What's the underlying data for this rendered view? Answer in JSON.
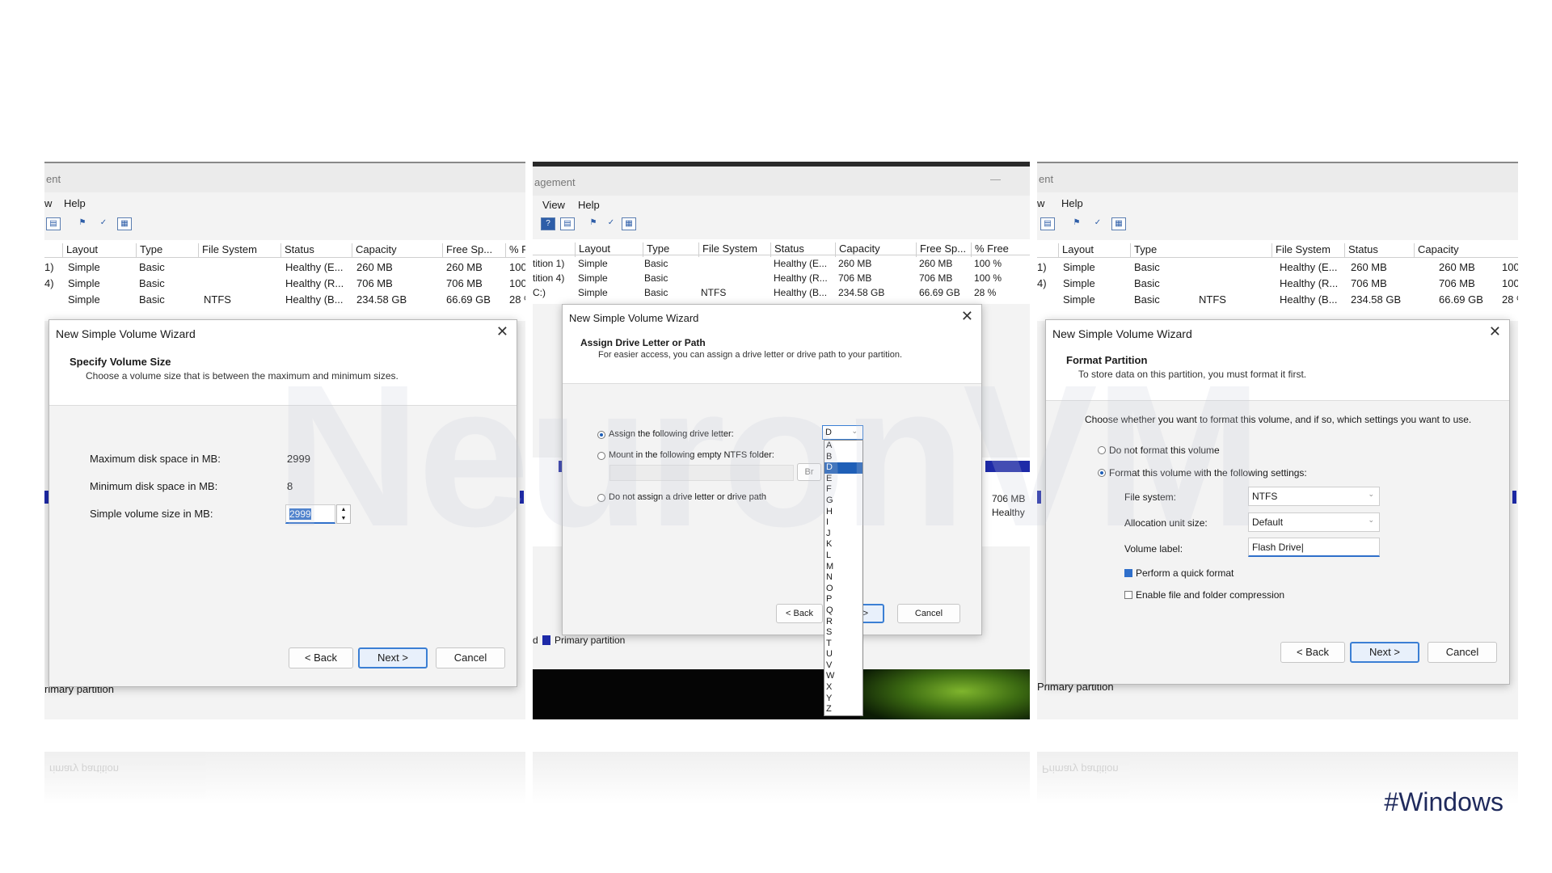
{
  "colors": {
    "accent": "#2f6fca",
    "partition": "#1e2aa8",
    "hashtag": "#1f2a5c"
  },
  "hashtag": "#Windows",
  "watermark": "NeuronVM",
  "grid_headers": [
    "Layout",
    "Type",
    "File System",
    "Status",
    "Capacity",
    "Free Sp...",
    "% Free"
  ],
  "grid_rows": [
    {
      "vol": "1)",
      "layout": "Simple",
      "type": "Basic",
      "fs": "",
      "status": "Healthy (E...",
      "capacity": "260 MB",
      "free": "260 MB",
      "pct": "100 %"
    },
    {
      "vol": "4)",
      "layout": "Simple",
      "type": "Basic",
      "fs": "",
      "status": "Healthy (R...",
      "capacity": "706 MB",
      "free": "706 MB",
      "pct": "100 %"
    },
    {
      "vol": "",
      "layout": "Simple",
      "type": "Basic",
      "fs": "NTFS",
      "status": "Healthy (B...",
      "capacity": "234.58 GB",
      "free": "66.69 GB",
      "pct": "28 %"
    }
  ],
  "panel1": {
    "window_title": "ent",
    "menu": [
      "w",
      "Help"
    ],
    "footer": "rimary partition",
    "dialog": {
      "title": "New Simple Volume Wizard",
      "heading": "Specify Volume Size",
      "subheading": "Choose a volume size that is between the maximum and minimum sizes.",
      "max_label": "Maximum disk space in MB:",
      "max_value": "2999",
      "min_label": "Minimum disk space in MB:",
      "min_value": "8",
      "size_label": "Simple volume size in MB:",
      "size_value": "2999",
      "back": "< Back",
      "next": "Next >",
      "cancel": "Cancel"
    }
  },
  "panel2": {
    "window_title": "agement",
    "minimize": "—",
    "menu": [
      "View",
      "Help"
    ],
    "row_prefixes": [
      "tition 1)",
      "tition 4)",
      "C:)"
    ],
    "side_capacity": "706 MB",
    "side_status": "Healthy",
    "legend_prefix": "d",
    "legend": "Primary partition",
    "dialog": {
      "title": "New Simple Volume Wizard",
      "heading": "Assign Drive Letter or Path",
      "subheading": "For easier access, you can assign a drive letter or drive path to your partition.",
      "opt_assign": "Assign the following drive letter:",
      "opt_mount": "Mount in the following empty NTFS folder:",
      "opt_none": "Do not assign a drive letter or drive path",
      "browse_partial": "Br",
      "selected_letter": "D",
      "letters": [
        "A",
        "B",
        "D",
        "E",
        "F",
        "G",
        "H",
        "I",
        "J",
        "K",
        "L",
        "M",
        "N",
        "O",
        "P",
        "Q",
        "R",
        "S",
        "T",
        "U",
        "V",
        "W",
        "X",
        "Y",
        "Z"
      ],
      "back": "< Back",
      "next_partial": "ext >",
      "cancel": "Cancel"
    }
  },
  "panel3": {
    "window_title": "ent",
    "menu": [
      "w",
      "Help"
    ],
    "footer": "Primary partition",
    "dialog": {
      "title": "New Simple Volume Wizard",
      "heading": "Format Partition",
      "subheading": "To store data on this partition, you must format it first.",
      "prompt": "Choose whether you want to format this volume, and if so, which settings you want to use.",
      "opt_noformat": "Do not format this volume",
      "opt_format": "Format this volume with the following settings:",
      "fs_label": "File system:",
      "fs_value": "NTFS",
      "alloc_label": "Allocation unit size:",
      "alloc_value": "Default",
      "vol_label": "Volume label:",
      "vol_value": "Flash Drive",
      "quick": "Perform a quick format",
      "compress": "Enable file and folder compression",
      "back": "< Back",
      "next": "Next >",
      "cancel": "Cancel"
    }
  }
}
